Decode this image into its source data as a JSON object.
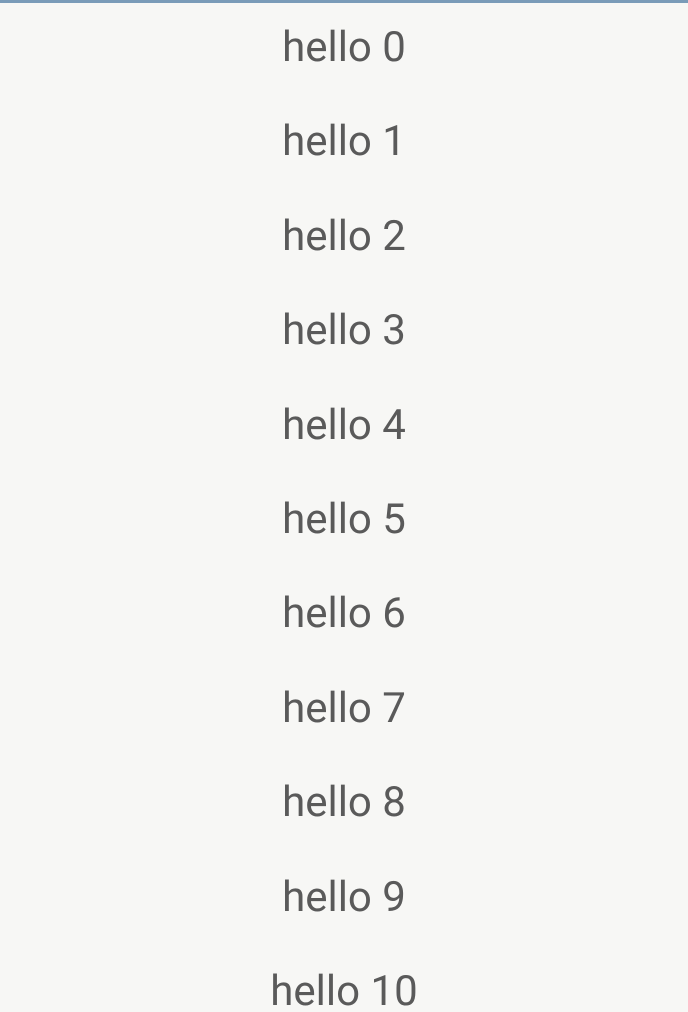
{
  "list": {
    "items": [
      {
        "label": "hello 0"
      },
      {
        "label": "hello 1"
      },
      {
        "label": "hello 2"
      },
      {
        "label": "hello 3"
      },
      {
        "label": "hello 4"
      },
      {
        "label": "hello 5"
      },
      {
        "label": "hello 6"
      },
      {
        "label": "hello 7"
      },
      {
        "label": "hello 8"
      },
      {
        "label": "hello 9"
      },
      {
        "label": "hello 10"
      }
    ]
  }
}
